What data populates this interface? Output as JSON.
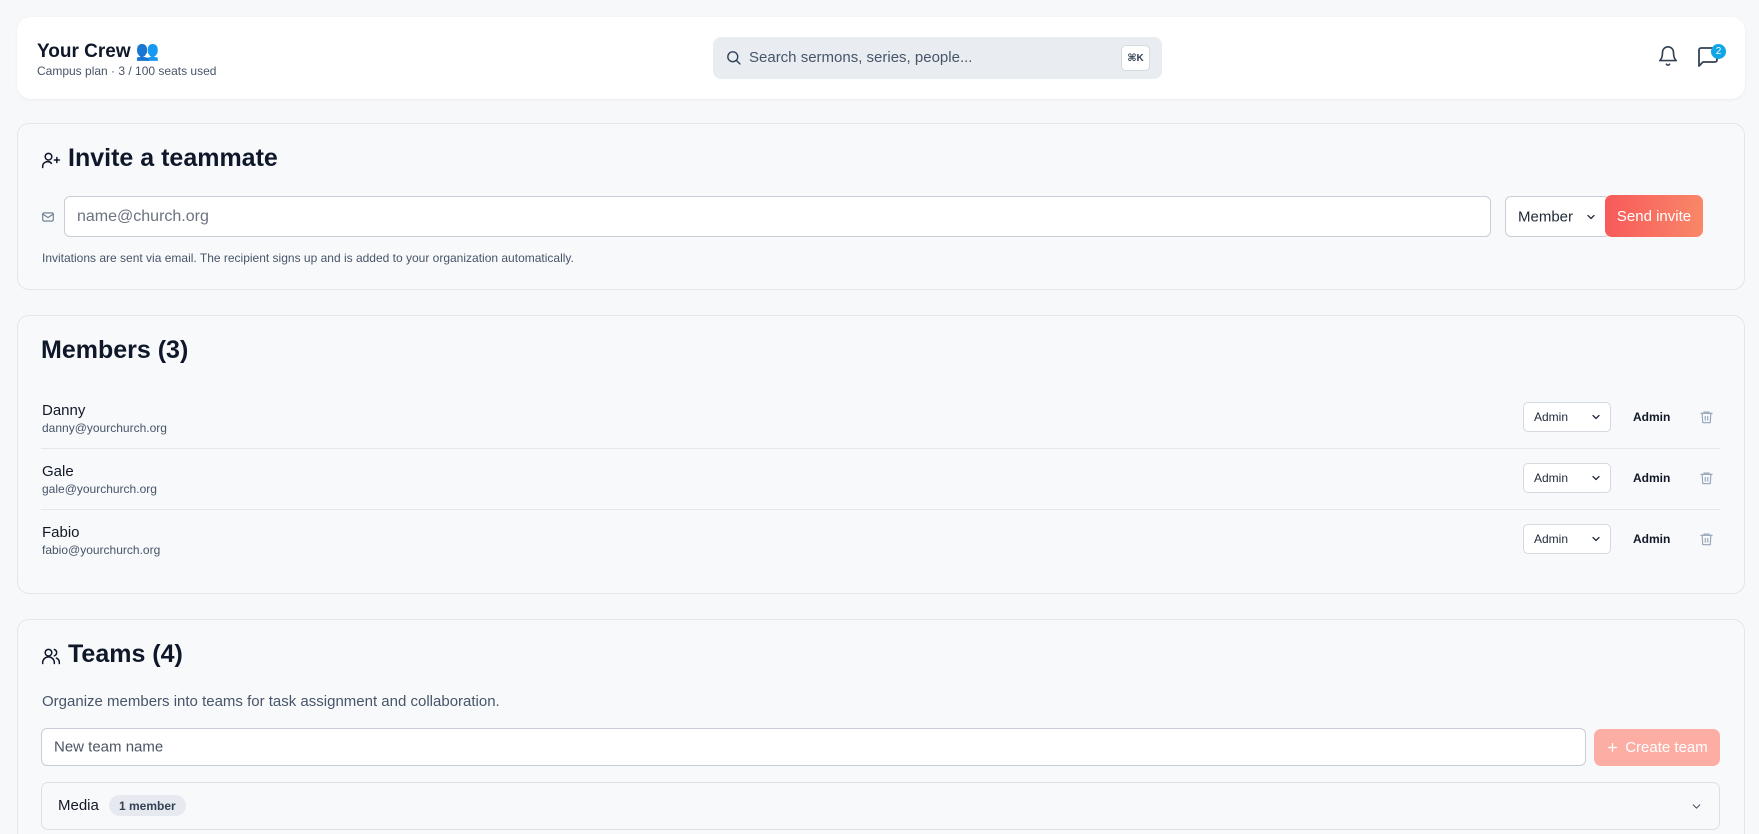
{
  "header": {
    "title": "Your Crew 👥",
    "subtitle": "Campus plan · 3 / 100 seats used",
    "search_placeholder": "Search sermons, series, people...",
    "search_shortcut": "⌘K",
    "notification_badge": "2"
  },
  "invite": {
    "title": "Invite a teammate",
    "email_placeholder": "name@church.org",
    "role_selected": "Member",
    "send_label": "Send invite",
    "note": "Invitations are sent via email. The recipient signs up and is added to your organization automatically."
  },
  "members": {
    "title": "Members (3)",
    "list": [
      {
        "name": "Danny",
        "email": "danny@yourchurch.org",
        "role_select": "Admin",
        "role": "Admin"
      },
      {
        "name": "Gale",
        "email": "gale@yourchurch.org",
        "role_select": "Admin",
        "role": "Admin"
      },
      {
        "name": "Fabio",
        "email": "fabio@yourchurch.org",
        "role_select": "Admin",
        "role": "Admin"
      }
    ]
  },
  "teams": {
    "title": "Teams (4)",
    "description": "Organize members into teams for task assignment and collaboration.",
    "new_team_placeholder": "New team name",
    "create_label": "Create team",
    "list": [
      {
        "name": "Media",
        "count": "1 member"
      }
    ]
  },
  "colors": {
    "accent": "#f75a5a",
    "badge": "#0ea5e9",
    "create_disabled": "#fcaea4"
  }
}
